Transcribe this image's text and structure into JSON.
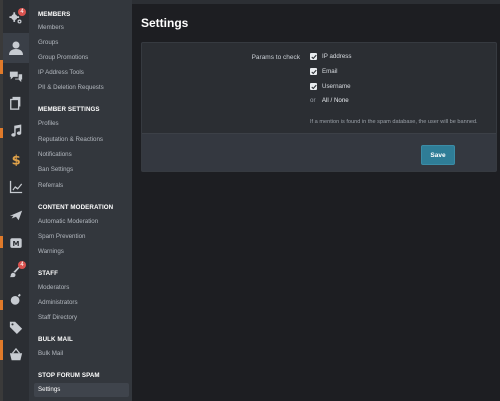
{
  "rail": {
    "items": [
      {
        "icon": "gears-icon",
        "badge": "4"
      },
      {
        "icon": "user-icon",
        "active": true
      },
      {
        "icon": "chat-icon"
      },
      {
        "icon": "pages-icon"
      },
      {
        "icon": "music-icon"
      },
      {
        "icon": "dollar-icon"
      },
      {
        "icon": "chart-icon"
      },
      {
        "icon": "plane-icon"
      },
      {
        "icon": "mail-m-icon"
      },
      {
        "icon": "brush-icon",
        "badge": "4"
      },
      {
        "icon": "bomb-icon"
      },
      {
        "icon": "tags-icon"
      },
      {
        "icon": "basket-icon"
      }
    ]
  },
  "nav": {
    "members_head": "MEMBERS",
    "members": [
      "Members",
      "Groups",
      "Group Promotions",
      "IP Address Tools",
      "PII & Deletion Requests"
    ],
    "member_settings_head": "MEMBER SETTINGS",
    "member_settings": [
      "Profiles",
      "Reputation & Reactions",
      "Notifications",
      "Ban Settings",
      "Referrals"
    ],
    "content_moderation_head": "CONTENT MODERATION",
    "content_moderation": [
      "Automatic Moderation",
      "Spam Prevention",
      "Warnings"
    ],
    "staff_head": "STAFF",
    "staff": [
      "Moderators",
      "Administrators",
      "Staff Directory"
    ],
    "bulk_mail_head": "BULK MAIL",
    "bulk_mail": [
      "Bulk Mail"
    ],
    "stop_forum_spam_head": "STOP FORUM SPAM",
    "stop_forum_spam": [
      "Settings"
    ]
  },
  "main": {
    "title": "Settings",
    "params_label": "Params to check",
    "checks": [
      {
        "label": "IP address",
        "checked": true
      },
      {
        "label": "Email",
        "checked": true
      },
      {
        "label": "Username",
        "checked": true
      }
    ],
    "or_text": "or",
    "all_none": "All / None",
    "explanation": "If a mention is found in the spam database, the user will be banned.",
    "save_label": "Save"
  },
  "colors": {
    "accent": "#2f7d97",
    "badge": "#d9534f",
    "sidebar": "#33373d",
    "rail": "#2b2e33",
    "background": "#1d1e22"
  }
}
